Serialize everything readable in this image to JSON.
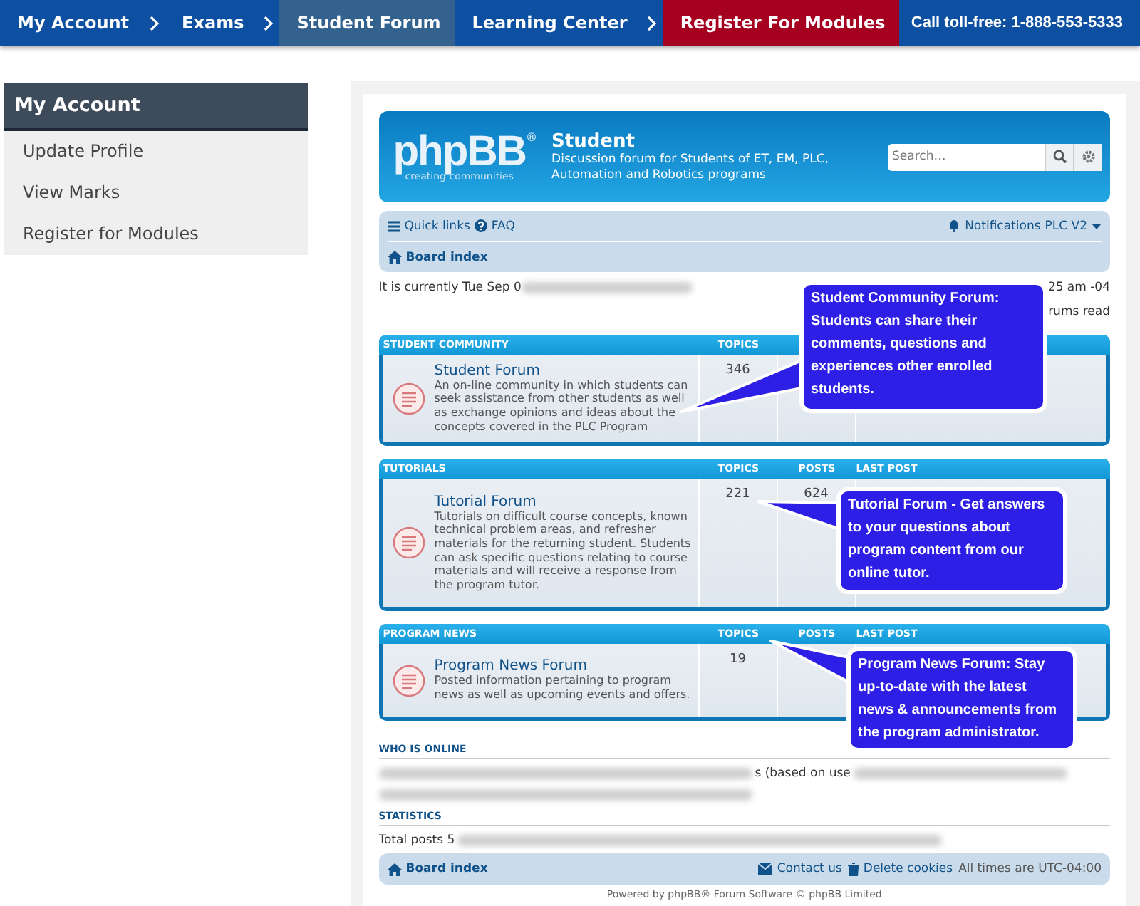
{
  "top_nav": {
    "items": [
      {
        "label": "My Account",
        "selected": false,
        "kind": "plain",
        "chevron": true
      },
      {
        "label": "Exams",
        "selected": false,
        "kind": "plain",
        "chevron": true
      },
      {
        "label": "Student Forum",
        "selected": true,
        "kind": "plain",
        "chevron": false
      },
      {
        "label": "Learning Center",
        "selected": false,
        "kind": "plain",
        "chevron": true
      },
      {
        "label": "Register For Modules",
        "selected": false,
        "kind": "highlight",
        "chevron": false
      }
    ],
    "phone": "Call toll-free: 1-888-553-5333"
  },
  "sidebar": {
    "title": "My Account",
    "items": [
      {
        "label": "Update Profile"
      },
      {
        "label": "View Marks"
      },
      {
        "label": "Register for Modules"
      }
    ]
  },
  "forum": {
    "logo": {
      "word": "phpBB",
      "tagline": "creating communities",
      "mark": "®"
    },
    "site_title": "Student",
    "site_description": "Discussion forum for Students of ET, EM, PLC, Automation and Robotics programs",
    "search": {
      "placeholder": "Search…"
    },
    "navbar": {
      "quick_links": "Quick links",
      "faq": "FAQ",
      "notifications": "Notifications",
      "user": "PLC V2",
      "breadcrumb": "Board index"
    },
    "current_time": {
      "prefix": "It is currently Tue Sep 0",
      "suffix": "25 am -04"
    },
    "mark_read": "rums read",
    "categories": [
      {
        "title": "STUDENT COMMUNITY",
        "columns": [
          "TOPICS"
        ],
        "forums": [
          {
            "name": "Student Forum",
            "description": "An on-line community in which students can seek assistance from other students as well as exchange opinions and ideas about the concepts covered in the PLC Program",
            "topics": "346"
          }
        ]
      },
      {
        "title": "TUTORIALS",
        "columns": [
          "TOPICS",
          "POSTS",
          "LAST POST"
        ],
        "forums": [
          {
            "name": "Tutorial Forum",
            "description": "Tutorials on difficult course concepts, known technical problem areas, and refresher materials for the returning student. Students can ask specific questions relating to course materials and will receive a response from the program tutor.",
            "topics": "221",
            "posts": "624"
          }
        ]
      },
      {
        "title": "PROGRAM NEWS",
        "columns": [
          "TOPICS",
          "POSTS",
          "LAST POST"
        ],
        "forums": [
          {
            "name": "Program News Forum",
            "description": "Posted information pertaining to program news as well as upcoming events and offers.",
            "topics": "19"
          }
        ]
      }
    ],
    "who_is_online": {
      "title": "WHO IS ONLINE",
      "visible_text": "s (based on use"
    },
    "statistics": {
      "title": "STATISTICS",
      "prefix": "Total posts 5"
    },
    "footer": {
      "board_index": "Board index",
      "contact": "Contact us",
      "delete_cookies": "Delete cookies",
      "timezone": "All times are UTC-04:00"
    },
    "powered_by": "Powered by phpBB® Forum Software © phpBB Limited"
  },
  "callouts": [
    {
      "text": "Student Community Forum: Students can share their comments, questions and experiences other enrolled students."
    },
    {
      "text": "Tutorial Forum - Get answers to your questions about program content from our online tutor."
    },
    {
      "text": "Program News Forum: Stay up-to-date with the latest news & announcements from the program administrator."
    }
  ]
}
